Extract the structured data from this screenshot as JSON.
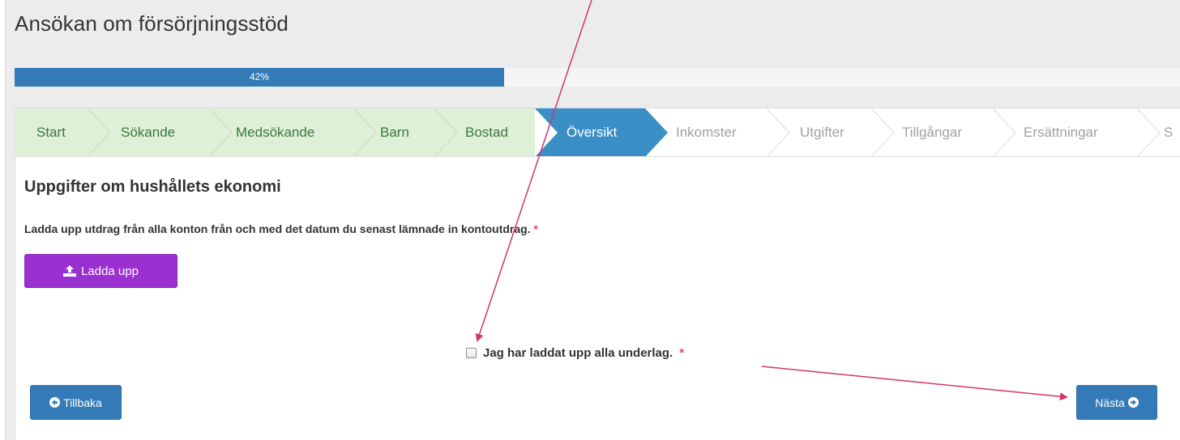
{
  "page": {
    "title": "Ansökan om försörjningsstöd"
  },
  "progress": {
    "value_percent": 42,
    "label": "42%"
  },
  "wizard": {
    "steps": [
      {
        "label": "Start",
        "state": "done"
      },
      {
        "label": "Sökande",
        "state": "done"
      },
      {
        "label": "Medsökande",
        "state": "done"
      },
      {
        "label": "Barn",
        "state": "done"
      },
      {
        "label": "Bostad",
        "state": "done"
      },
      {
        "label": "Översikt",
        "state": "active"
      },
      {
        "label": "Inkomster",
        "state": "todo"
      },
      {
        "label": "Utgifter",
        "state": "todo"
      },
      {
        "label": "Tillgångar",
        "state": "todo"
      },
      {
        "label": "Ersättningar",
        "state": "todo"
      },
      {
        "label": "S",
        "state": "todo"
      }
    ]
  },
  "section": {
    "heading": "Uppgifter om hushållets ekonomi",
    "instruction": "Ladda upp utdrag från alla konton från och med det datum du senast lämnade in kontoutdrag.",
    "required_marker": "*",
    "upload_label": "Ladda upp",
    "upload_icon": "upload-icon"
  },
  "confirm": {
    "label": "Jag har laddat upp alla underlag.",
    "required_marker": "*",
    "checked": false
  },
  "navigation": {
    "back_label": "Tillbaka",
    "back_icon": "circle-arrow-left-icon",
    "next_label": "Nästa",
    "next_icon": "circle-arrow-right-icon"
  },
  "colors": {
    "progress": "#337ab7",
    "step_done_bg": "#dff0d8",
    "step_done_text": "#3c763d",
    "step_active_bg": "#3a8fc7",
    "upload_button": "#9b30d0",
    "primary_button": "#337ab7",
    "annotation_arrow": "#d6336c"
  }
}
